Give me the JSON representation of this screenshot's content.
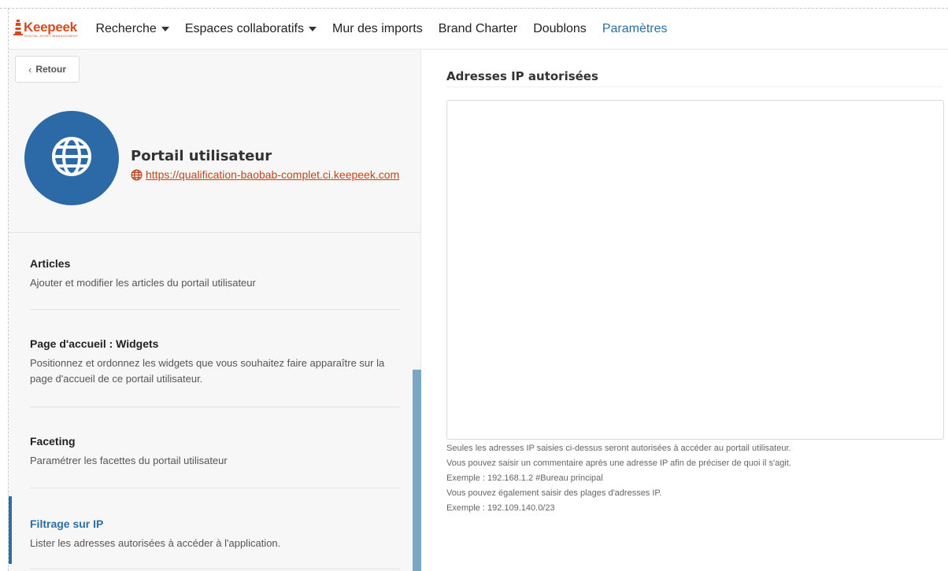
{
  "brand": {
    "name": "Keepeek",
    "tagline": "DIGITAL ASSET MANAGEMENT",
    "color": "#d84a1b"
  },
  "nav": {
    "items": [
      {
        "label": "Recherche",
        "dropdown": true,
        "active": false
      },
      {
        "label": "Espaces collaboratifs",
        "dropdown": true,
        "active": false
      },
      {
        "label": "Mur des imports",
        "dropdown": false,
        "active": false
      },
      {
        "label": "Brand Charter",
        "dropdown": false,
        "active": false
      },
      {
        "label": "Doublons",
        "dropdown": false,
        "active": false
      },
      {
        "label": "Paramètres",
        "dropdown": false,
        "active": true
      }
    ]
  },
  "sidebar": {
    "back_label": "Retour",
    "portal": {
      "title": "Portail utilisateur",
      "url": "https://qualification-baobab-complet.ci.keepeek.com",
      "icon": "globe-icon"
    },
    "items": [
      {
        "title": "Articles",
        "description": "Ajouter et modifier les articles du portail utilisateur"
      },
      {
        "title": "Page d'accueil : Widgets",
        "description": "Positionnez et ordonnez les widgets que vous souhaitez faire apparaître sur la page d'accueil de ce portail utilisateur."
      },
      {
        "title": "Faceting",
        "description": "Paramétrer les facettes du portail utilisateur"
      },
      {
        "title": "Filtrage sur IP",
        "description": "Lister les adresses autorisées à accéder à l'application.",
        "active": true
      }
    ]
  },
  "main": {
    "title": "Adresses IP autorisées",
    "ip_list_value": "",
    "help_lines": [
      "Seules les adresses IP saisies ci-dessus seront autorisées à accéder au portail utilisateur.",
      "Vous pouvez saisir un commentaire après une adresse IP afin de préciser de quoi il s'agit.",
      "Exemple : 192.168.1.2 #Bureau principal",
      "Vous pouvez également saisir des plages d'adresses IP.",
      "Exemple : 192.109.140.0/23"
    ]
  },
  "colors": {
    "accent": "#2e6ea6",
    "avatar_bg": "#2c6aa7",
    "link": "#c0451c"
  }
}
